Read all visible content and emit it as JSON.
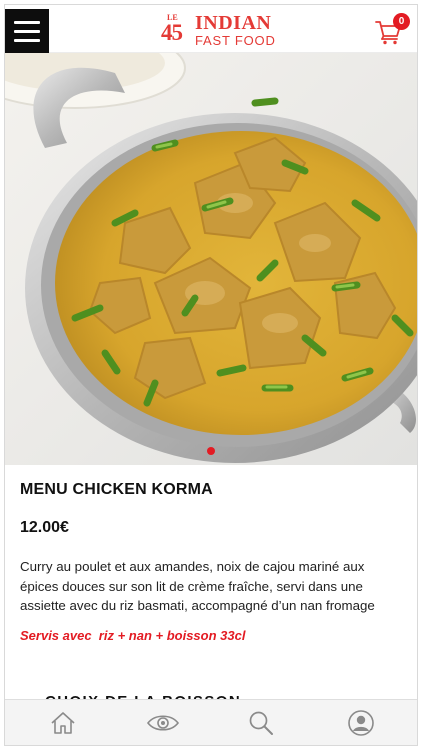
{
  "header": {
    "logo_le": "LE",
    "logo_number": "45",
    "logo_brand": "INDIAN",
    "logo_tagline": "FAST FOOD",
    "cart_count": "0",
    "accent_color": "#e43a36"
  },
  "hero": {
    "image_icon": "chicken-korma-photo",
    "carousel_dots": 1,
    "active_dot": 0
  },
  "product": {
    "title": "MENU CHICKEN KORMA",
    "price": "12.00€",
    "description": "Curry au poulet et aux amandes, noix de cajou mariné aux épices douces sur son lit de crème fraîche, servi dans une assiette avec du riz basmati, accompagné d’un nan fromage",
    "served_with": "Servis avec  riz + nan + boisson 33cl",
    "section_heading": "CHOIX DE LA BOISSON"
  },
  "bottom_nav": {
    "items": [
      "home-icon",
      "eye-icon",
      "search-icon",
      "user-icon"
    ]
  }
}
